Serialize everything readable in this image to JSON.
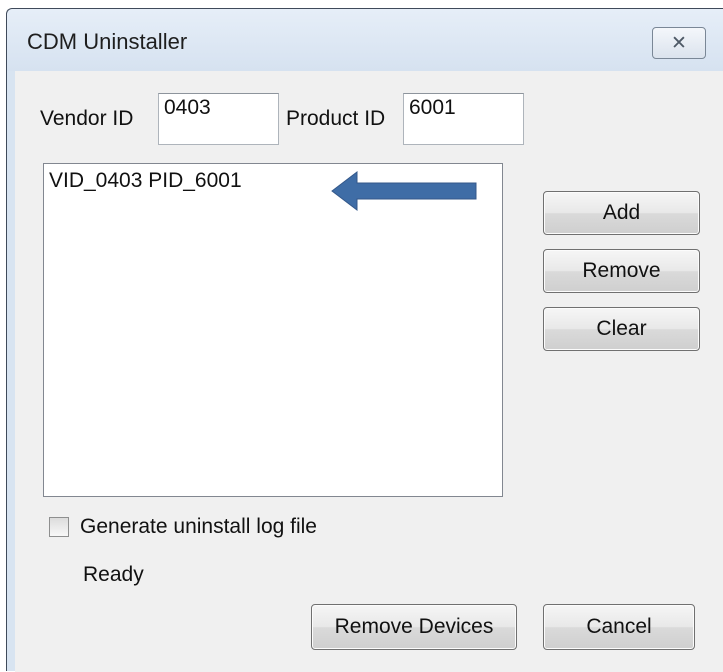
{
  "window": {
    "title": "CDM Uninstaller",
    "close_label": "✕"
  },
  "vendor": {
    "label": "Vendor ID",
    "value": "0403"
  },
  "product": {
    "label": "Product ID",
    "value": "6001"
  },
  "device_list": {
    "items": [
      "VID_0403 PID_6001"
    ]
  },
  "buttons": {
    "add": "Add",
    "remove": "Remove",
    "clear": "Clear",
    "remove_devices": "Remove Devices",
    "cancel": "Cancel"
  },
  "log_option": {
    "label": "Generate uninstall log file",
    "checked": false
  },
  "status": {
    "text": "Ready"
  },
  "colors": {
    "annotation_arrow": "#3f6da6"
  }
}
